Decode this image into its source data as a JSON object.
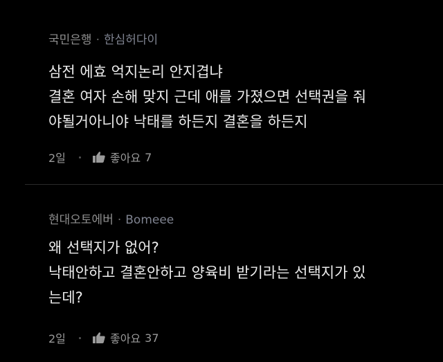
{
  "comments": [
    {
      "author": "국민은행",
      "separator": "·",
      "nickname": "한심허다이",
      "lines": [
        "삼전 에효 억지논리 안지겹냐",
        "결혼 여자 손해 맞지 근데 애를 가졌으면 선택권을 줘",
        "야될거아니야 낙태를 하든지 결혼을 하든지"
      ],
      "date": "2일",
      "like_label": "좋아요",
      "like_count": "7"
    },
    {
      "author": "현대오토에버",
      "separator": "·",
      "nickname": "Bomeee",
      "lines": [
        "왜 선택지가 없어?",
        "낙태안하고 결혼안하고 양육비 받기라는 선택지가 있",
        "는데?"
      ],
      "date": "2일",
      "like_label": "좋아요",
      "like_count": "37"
    }
  ],
  "icons": {
    "like": "thumbs-up-icon"
  },
  "colors": {
    "background": "#000000",
    "text": "#ececec",
    "meta": "#8f8f8f"
  }
}
